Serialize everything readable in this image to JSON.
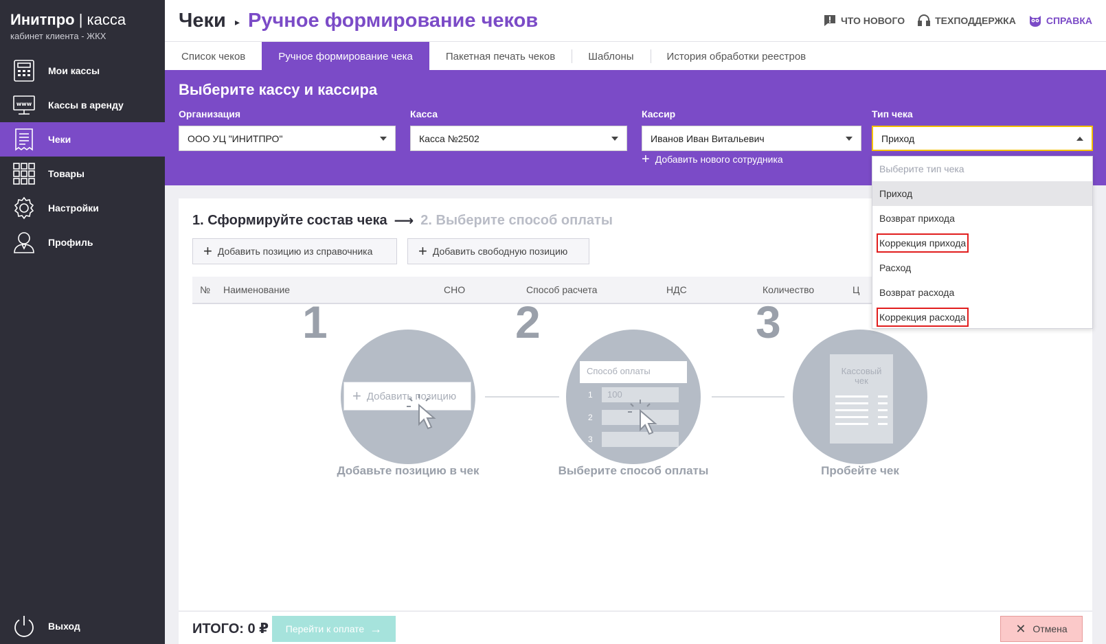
{
  "brand": {
    "name": "Инитпро",
    "separator": " | ",
    "product": "касса",
    "subtitle": "кабинет клиента - ЖКХ"
  },
  "sidebar": {
    "items": [
      {
        "label": "Мои кассы",
        "icon": "cash-register-icon",
        "active": false
      },
      {
        "label": "Кассы в аренду",
        "icon": "web-terminal-icon",
        "active": false
      },
      {
        "label": "Чеки",
        "icon": "receipt-icon",
        "active": true
      },
      {
        "label": "Товары",
        "icon": "grid-icon",
        "active": false
      },
      {
        "label": "Настройки",
        "icon": "gear-icon",
        "active": false
      },
      {
        "label": "Профиль",
        "icon": "user-icon",
        "active": false
      }
    ],
    "logout": "Выход"
  },
  "header": {
    "root": "Чеки",
    "current": "Ручное формирование чеков",
    "links": {
      "news": "ЧТО НОВОГО",
      "support": "ТЕХПОДДЕРЖКА",
      "help": "СПРАВКА"
    }
  },
  "tabs": [
    "Список чеков",
    "Ручное формирование чека",
    "Пакетная печать чеков",
    "Шаблоны",
    "История обработки реестров"
  ],
  "panel": {
    "title": "Выберите кассу и кассира",
    "org": {
      "label": "Организация",
      "value": "ООО УЦ \"ИНИТПРО\""
    },
    "kassa": {
      "label": "Касса",
      "value": "Касса №2502"
    },
    "cashier": {
      "label": "Кассир",
      "value": "Иванов Иван Витальевич"
    },
    "type": {
      "label": "Тип чека",
      "value": "Приход"
    },
    "add_employee": "Добавить нового сотрудника"
  },
  "dropdown": {
    "placeholder": "Выберите тип чека",
    "options": [
      "Приход",
      "Возврат прихода",
      "Коррекция прихода",
      "Расход",
      "Возврат расхода",
      "Коррекция расхода"
    ]
  },
  "main": {
    "step1": "1. Сформируйте состав чека",
    "arrow": "⟶",
    "step2": "2. Выберите способ оплаты",
    "add_from_catalog": "Добавить позицию из справочника",
    "add_free": "Добавить свободную позицию",
    "columns": [
      "№",
      "Наименование",
      "СНО",
      "Способ расчета",
      "НДС",
      "Количество",
      "Ц"
    ]
  },
  "illustrations": {
    "step_numbers": [
      "1",
      "2",
      "3"
    ],
    "labels": [
      "Добавьте позицию в чек",
      "Выберите способ оплаты",
      "Пробейте чек"
    ],
    "add_position_btn": "Добавить позицию",
    "payment_method": "Способ оплаты",
    "amount": "100",
    "rows": [
      "1",
      "2",
      "3"
    ],
    "receipt_text_1": "Кассовый",
    "receipt_text_2": "чек"
  },
  "footer": {
    "total": "ИТОГО: 0 ₽",
    "pay": "Перейти к оплате",
    "cancel": "Отмена"
  },
  "colors": {
    "accent": "#7b4bc7",
    "sidebar": "#2e2e38",
    "pay_button": "#a6e3dc",
    "cancel_button": "#fbc9c9",
    "highlight": "#e11d1d"
  }
}
